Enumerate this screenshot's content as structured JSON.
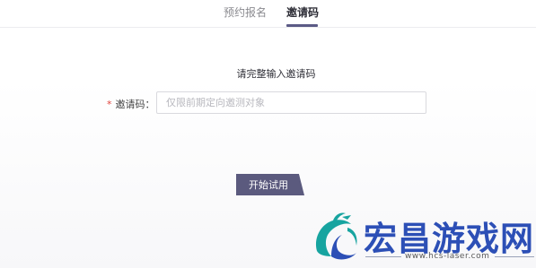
{
  "tabs": [
    {
      "label": "预约报名",
      "active": false
    },
    {
      "label": "邀请码",
      "active": true
    }
  ],
  "form": {
    "prompt": "请完整输入邀请码",
    "required_mark": "*",
    "code_label": "邀请码：",
    "code_placeholder": "仅限前期定向邀测对象",
    "code_value": "",
    "submit_label": "开始试用"
  },
  "watermark": {
    "title": "宏昌游戏网",
    "url": "www.hcs-laser.com"
  },
  "colors": {
    "accent": "#5b5a7e",
    "required": "#e0443d",
    "watermark_blue": "#2c4fb6",
    "watermark_teal": "#17a4a0"
  }
}
